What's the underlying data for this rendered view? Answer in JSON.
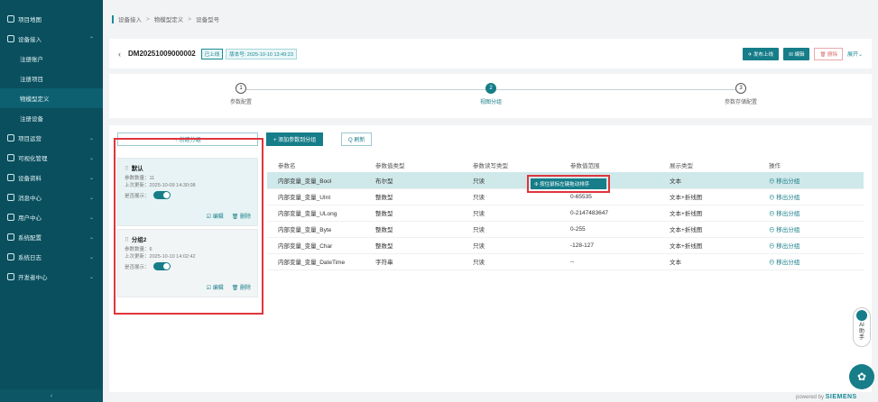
{
  "sidebar": {
    "items": [
      {
        "label": "项目地图",
        "chevron": ""
      },
      {
        "label": "设备接入",
        "chevron": "⌃"
      },
      {
        "label": "注册账户",
        "chevron": "",
        "sub": true
      },
      {
        "label": "注册项目",
        "chevron": "",
        "sub": true
      },
      {
        "label": "物模型定义",
        "chevron": "",
        "sub": true,
        "active": true
      },
      {
        "label": "注册设备",
        "chevron": "",
        "sub": true
      },
      {
        "label": "项目运营",
        "chevron": "⌄"
      },
      {
        "label": "可视化管理",
        "chevron": "⌄"
      },
      {
        "label": "设备资料",
        "chevron": "⌄"
      },
      {
        "label": "消息中心",
        "chevron": "⌄"
      },
      {
        "label": "用户中心",
        "chevron": "⌄"
      },
      {
        "label": "系统配置",
        "chevron": "⌄"
      },
      {
        "label": "系统日志",
        "chevron": "⌄"
      },
      {
        "label": "开发者中心",
        "chevron": "⌄"
      }
    ],
    "collapse": "‹"
  },
  "breadcrumb": [
    "设备接入",
    "物模型定义",
    "设备型号"
  ],
  "header": {
    "back": "‹",
    "title": "DM20251009000002",
    "status": "已上线",
    "version": "版本号: 2025-10-10 13:49:23",
    "publish": "✈ 发布上线",
    "edit": "☒ 编辑",
    "delete": "🗑 删除",
    "expand": "展开⌄"
  },
  "steps": [
    {
      "num": "1",
      "label": "参数配置"
    },
    {
      "num": "2",
      "label": "视图分组"
    },
    {
      "num": "3",
      "label": "参数存储配置"
    }
  ],
  "groups": {
    "create_label": "+ 创建分组",
    "items": [
      {
        "name": "默认",
        "count_label": "参数数量：",
        "count": "11",
        "update_label": "上次更新：",
        "updated": "2025-10-09 14:30:08",
        "show_label": "是否展示：",
        "edit": "☑ 编辑",
        "delete": "🗑 删除"
      },
      {
        "name": "分组2",
        "count_label": "参数数量：",
        "count": "6",
        "update_label": "上次更新：",
        "updated": "2025-10-10 14:02:42",
        "show_label": "是否展示：",
        "edit": "☑ 编辑",
        "delete": "🗑 删除"
      }
    ]
  },
  "toolbar": {
    "add": "+ 添加参数到分组",
    "refresh": "Q 刷新"
  },
  "table": {
    "headers": [
      "参数名",
      "参数值类型",
      "参数读写类型",
      "参数值范围",
      "展示类型",
      "操作"
    ],
    "rows": [
      [
        "内部变量_变量_Bool",
        "布尔型",
        "只读",
        "",
        "文本",
        "⊖ 移出分组"
      ],
      [
        "内部变量_变量_UInt",
        "整数型",
        "只读",
        "0-65535",
        "文本+折线图",
        "⊖ 移出分组"
      ],
      [
        "内部变量_变量_ULong",
        "整数型",
        "只读",
        "0-2147483647",
        "文本+折线图",
        "⊖ 移出分组"
      ],
      [
        "内部变量_变量_Byte",
        "整数型",
        "只读",
        "0-255",
        "文本+折线图",
        "⊖ 移出分组"
      ],
      [
        "内部变量_变量_Char",
        "整数型",
        "只读",
        "-128-127",
        "文本+折线图",
        "⊖ 移出分组"
      ],
      [
        "内部变量_变量_DateTime",
        "字符串",
        "只读",
        "--",
        "文本",
        "⊖ 移出分组"
      ]
    ],
    "tooltip": "✣ 按住鼠标左键拖动排序"
  },
  "ai": {
    "label": "AI\n助\n手"
  },
  "fab_icon": "✿",
  "powered": {
    "prefix": "powered by",
    "brand": "SIEMENS"
  }
}
